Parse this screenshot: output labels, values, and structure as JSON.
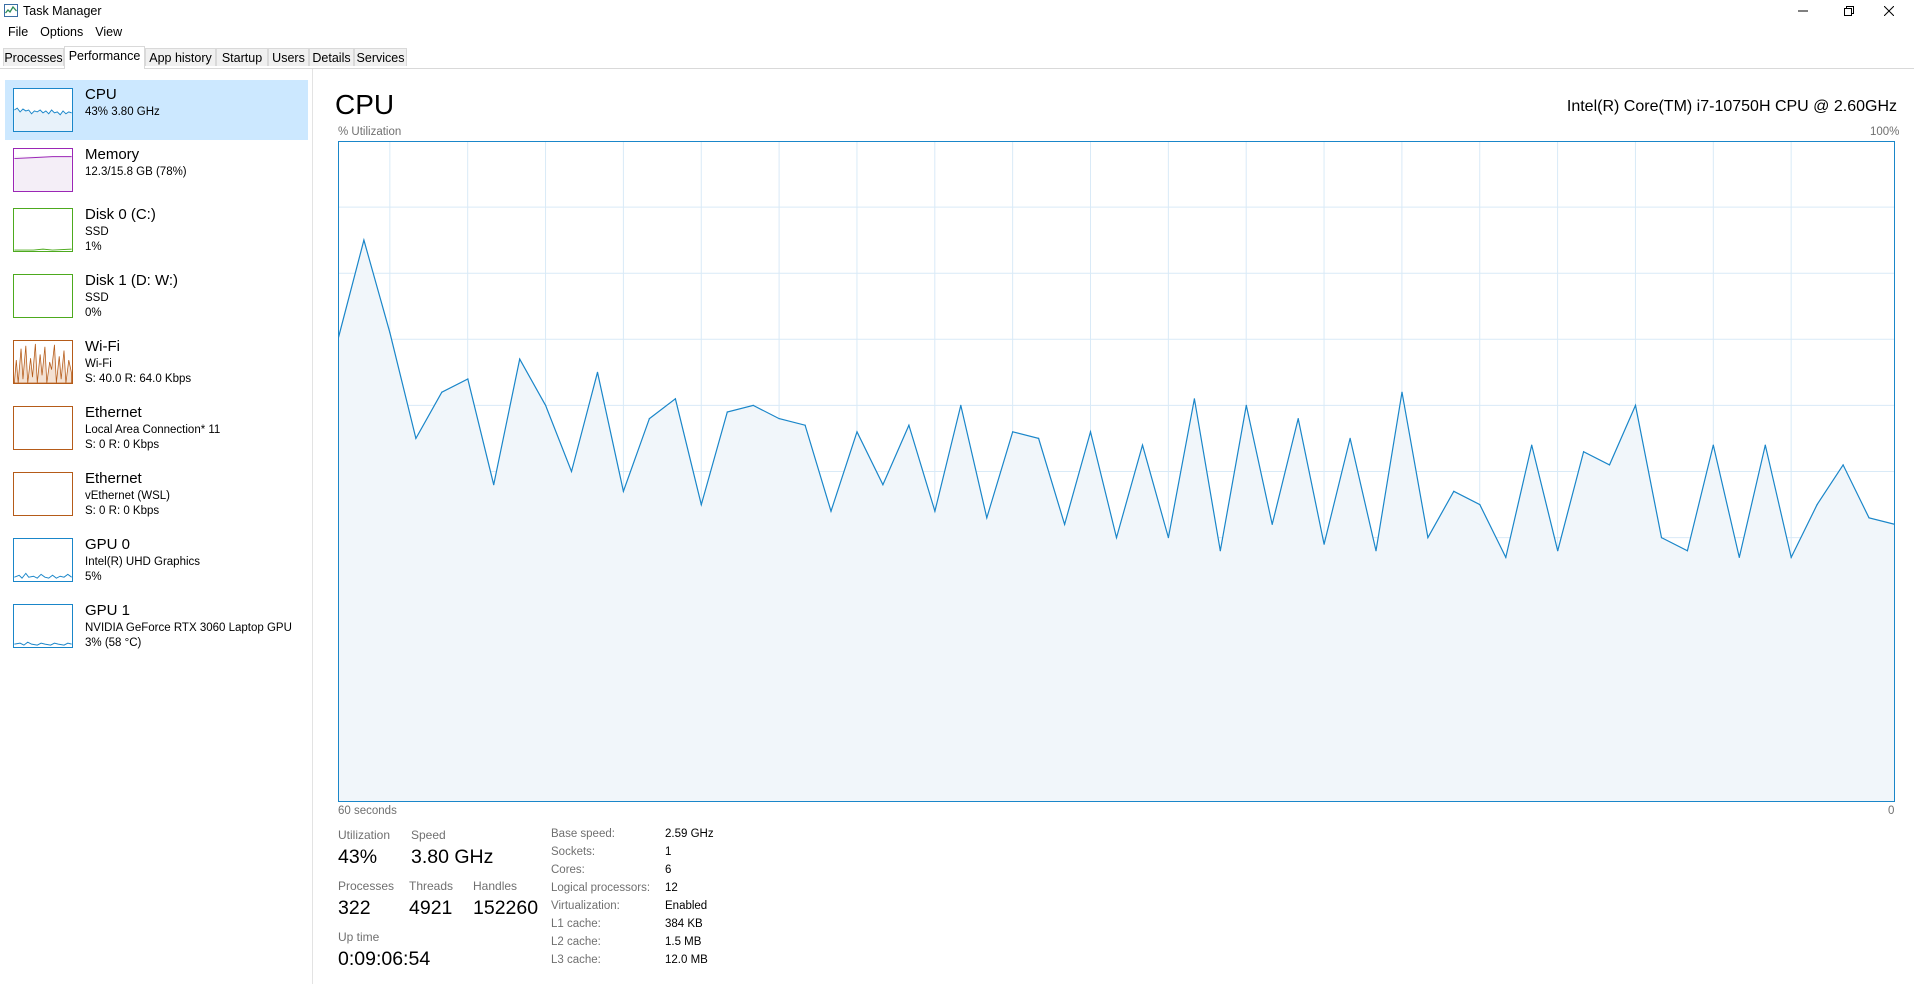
{
  "window": {
    "title": "Task Manager"
  },
  "menu": [
    "File",
    "Options",
    "View"
  ],
  "tabs": [
    "Processes",
    "Performance",
    "App history",
    "Startup",
    "Users",
    "Details",
    "Services"
  ],
  "active_tab": "Performance",
  "sidebar": {
    "items": [
      {
        "title": "CPU",
        "lines": [
          "43%  3.80 GHz"
        ],
        "color": "#1a86c9"
      },
      {
        "title": "Memory",
        "lines": [
          "12.3/15.8 GB (78%)"
        ],
        "color": "#9b26b6"
      },
      {
        "title": "Disk 0 (C:)",
        "lines": [
          "SSD",
          "1%"
        ],
        "color": "#4daa1e"
      },
      {
        "title": "Disk 1 (D: W:)",
        "lines": [
          "SSD",
          "0%"
        ],
        "color": "#4daa1e"
      },
      {
        "title": "Wi-Fi",
        "lines": [
          "Wi-Fi",
          "S: 40.0  R: 64.0 Kbps"
        ],
        "color": "#b55b19"
      },
      {
        "title": "Ethernet",
        "lines": [
          "Local Area Connection* 11",
          "S: 0  R: 0 Kbps"
        ],
        "color": "#b55b19"
      },
      {
        "title": "Ethernet",
        "lines": [
          "vEthernet (WSL)",
          "S: 0  R: 0 Kbps"
        ],
        "color": "#b55b19"
      },
      {
        "title": "GPU 0",
        "lines": [
          "Intel(R) UHD Graphics",
          "5%"
        ],
        "color": "#1a86c9"
      },
      {
        "title": "GPU 1",
        "lines": [
          "NVIDIA GeForce RTX 3060 Laptop GPU",
          "3% (58 °C)"
        ],
        "color": "#1a86c9"
      }
    ]
  },
  "main": {
    "title": "CPU",
    "model": "Intel(R) Core(TM) i7-10750H CPU @ 2.60GHz",
    "graph_label": "% Utilization",
    "graph_max_label": "100%",
    "time_label": "60 seconds",
    "zero_label": "0"
  },
  "stats": {
    "utilization_label": "Utilization",
    "utilization": "43%",
    "speed_label": "Speed",
    "speed": "3.80 GHz",
    "processes_label": "Processes",
    "processes": "322",
    "threads_label": "Threads",
    "threads": "4921",
    "handles_label": "Handles",
    "handles": "152260",
    "uptime_label": "Up time",
    "uptime": "0:09:06:54"
  },
  "specs": [
    {
      "label": "Base speed:",
      "value": "2.59 GHz"
    },
    {
      "label": "Sockets:",
      "value": "1"
    },
    {
      "label": "Cores:",
      "value": "6"
    },
    {
      "label": "Logical processors:",
      "value": "12"
    },
    {
      "label": "Virtualization:",
      "value": "Enabled"
    },
    {
      "label": "L1 cache:",
      "value": "384 KB"
    },
    {
      "label": "L2 cache:",
      "value": "1.5 MB"
    },
    {
      "label": "L3 cache:",
      "value": "12.0 MB"
    }
  ],
  "colors": {
    "accent": "#1a86c9",
    "grid": "#d9eaf7",
    "fill": "#f1f6fa",
    "selected": "#cce8ff"
  },
  "chart_data": {
    "type": "area",
    "xlabel": "60 seconds",
    "ylabel": "% Utilization",
    "ylim": [
      0,
      100
    ],
    "x": [
      -60,
      -59,
      -58,
      -57,
      -56,
      -55,
      -54,
      -53,
      -52,
      -51,
      -50,
      -49,
      -48,
      -47,
      -46,
      -45,
      -44,
      -43,
      -42,
      -41,
      -40,
      -39,
      -38,
      -37,
      -36,
      -35,
      -34,
      -33,
      -32,
      -31,
      -30,
      -29,
      -28,
      -27,
      -26,
      -25,
      -24,
      -23,
      -22,
      -21,
      -20,
      -19,
      -18,
      -17,
      -16,
      -15,
      -14,
      -13,
      -12,
      -11,
      -10,
      -9,
      -8,
      -7,
      -6,
      -5,
      -4,
      -3,
      -2,
      -1,
      0
    ],
    "values": [
      70,
      85,
      71,
      55,
      62,
      64,
      48,
      67,
      60,
      50,
      65,
      47,
      58,
      61,
      45,
      59,
      60,
      58,
      57,
      44,
      56,
      48,
      57,
      44,
      60,
      43,
      56,
      55,
      42,
      56,
      40,
      54,
      40,
      61,
      38,
      60,
      42,
      58,
      39,
      55,
      38,
      62,
      40,
      47,
      45,
      37,
      54,
      38,
      53,
      51,
      60,
      40,
      38,
      54,
      37,
      54,
      37,
      45,
      51,
      43,
      42
    ]
  }
}
